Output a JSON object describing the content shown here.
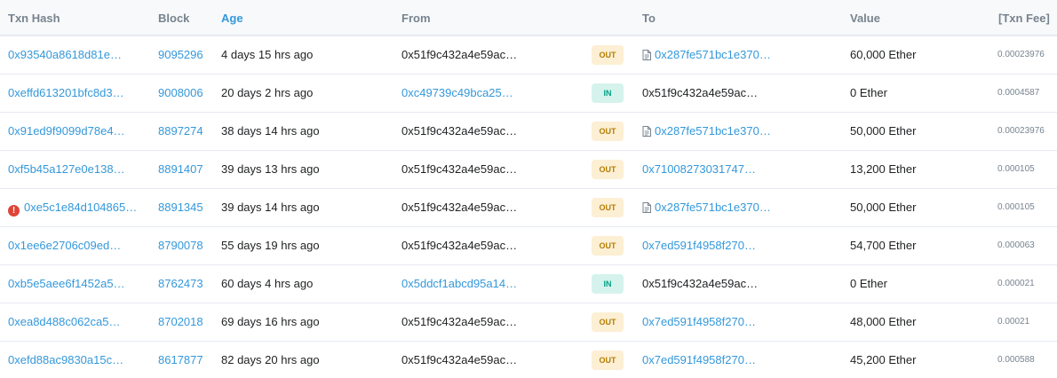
{
  "header": {
    "txn_hash": "Txn Hash",
    "block": "Block",
    "age": "Age",
    "from": "From",
    "to": "To",
    "value": "Value",
    "txn_fee": "[Txn Fee]"
  },
  "rows": [
    {
      "hash": "0x93540a8618d81e…",
      "error": false,
      "block": "9095296",
      "age": "4 days 15 hrs ago",
      "from": "0x51f9c432a4e59ac…",
      "from_link": false,
      "direction": "OUT",
      "to": "0x287fe571bc1e370…",
      "to_contract": true,
      "to_link": true,
      "value": "60,000 Ether",
      "fee": "0.00023976"
    },
    {
      "hash": "0xeffd613201bfc8d3…",
      "error": false,
      "block": "9008006",
      "age": "20 days 2 hrs ago",
      "from": "0xc49739c49bca25…",
      "from_link": true,
      "direction": "IN",
      "to": "0x51f9c432a4e59ac…",
      "to_contract": false,
      "to_link": false,
      "value": "0 Ether",
      "fee": "0.0004587"
    },
    {
      "hash": "0x91ed9f9099d78e4…",
      "error": false,
      "block": "8897274",
      "age": "38 days 14 hrs ago",
      "from": "0x51f9c432a4e59ac…",
      "from_link": false,
      "direction": "OUT",
      "to": "0x287fe571bc1e370…",
      "to_contract": true,
      "to_link": true,
      "value": "50,000 Ether",
      "fee": "0.00023976"
    },
    {
      "hash": "0xf5b45a127e0e138…",
      "error": false,
      "block": "8891407",
      "age": "39 days 13 hrs ago",
      "from": "0x51f9c432a4e59ac…",
      "from_link": false,
      "direction": "OUT",
      "to": "0x71008273031747…",
      "to_contract": false,
      "to_link": true,
      "value": "13,200 Ether",
      "fee": "0.000105"
    },
    {
      "hash": "0xe5c1e84d104865…",
      "error": true,
      "block": "8891345",
      "age": "39 days 14 hrs ago",
      "from": "0x51f9c432a4e59ac…",
      "from_link": false,
      "direction": "OUT",
      "to": "0x287fe571bc1e370…",
      "to_contract": true,
      "to_link": true,
      "value": "50,000 Ether",
      "fee": "0.000105"
    },
    {
      "hash": "0x1ee6e2706c09ed…",
      "error": false,
      "block": "8790078",
      "age": "55 days 19 hrs ago",
      "from": "0x51f9c432a4e59ac…",
      "from_link": false,
      "direction": "OUT",
      "to": "0x7ed591f4958f270…",
      "to_contract": false,
      "to_link": true,
      "value": "54,700 Ether",
      "fee": "0.000063"
    },
    {
      "hash": "0xb5e5aee6f1452a5…",
      "error": false,
      "block": "8762473",
      "age": "60 days 4 hrs ago",
      "from": "0x5ddcf1abcd95a14…",
      "from_link": true,
      "direction": "IN",
      "to": "0x51f9c432a4e59ac…",
      "to_contract": false,
      "to_link": false,
      "value": "0 Ether",
      "fee": "0.000021"
    },
    {
      "hash": "0xea8d488c062ca5…",
      "error": false,
      "block": "8702018",
      "age": "69 days 16 hrs ago",
      "from": "0x51f9c432a4e59ac…",
      "from_link": false,
      "direction": "OUT",
      "to": "0x7ed591f4958f270…",
      "to_contract": false,
      "to_link": true,
      "value": "48,000 Ether",
      "fee": "0.00021"
    },
    {
      "hash": "0xefd88ac9830a15c…",
      "error": false,
      "block": "8617877",
      "age": "82 days 20 hrs ago",
      "from": "0x51f9c432a4e59ac…",
      "from_link": false,
      "direction": "OUT",
      "to": "0x7ed591f4958f270…",
      "to_contract": false,
      "to_link": true,
      "value": "45,200 Ether",
      "fee": "0.000588"
    }
  ],
  "icons": {
    "error": "error-alert-icon",
    "contract": "contract-document-icon"
  },
  "colors": {
    "link": "#3498db",
    "out_badge_bg": "#fcefd3",
    "out_badge_text": "#b47d00",
    "in_badge_bg": "#d5f3ec",
    "in_badge_text": "#00a186",
    "error": "#de4437"
  }
}
